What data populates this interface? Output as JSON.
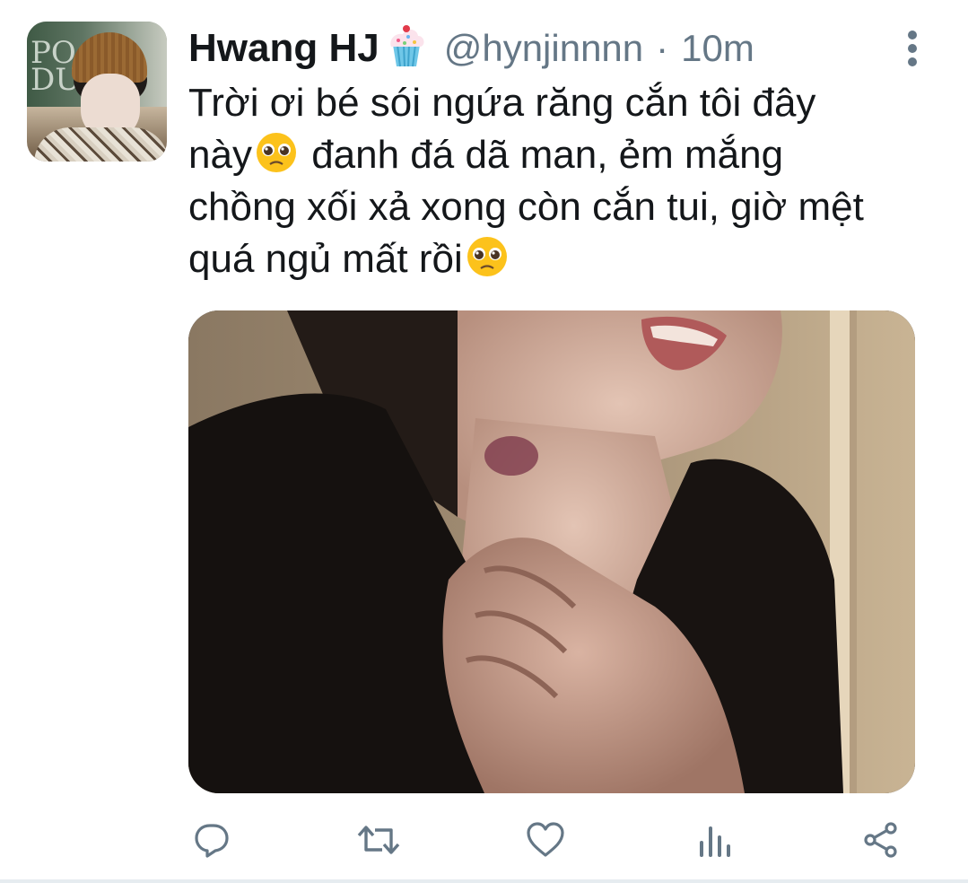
{
  "tweet": {
    "author_name": "Hwang HJ",
    "author_handle": "@hynjinnnn",
    "separator": "·",
    "time": "10m",
    "text_lines": [
      "Trời ơi bé sói ngứa răng cắn tôi đây",
      "này",
      "đanh đá dã man, ẻm mắng",
      "chồng xối xả xong còn cắn tui, giờ mệt",
      "quá ngủ mất rồi"
    ],
    "emoji_after_name": "cupcake-emoji",
    "emoji_in_text": "pleading-face-emoji"
  },
  "actions": [
    {
      "name": "reply",
      "icon": "reply-icon"
    },
    {
      "name": "retweet",
      "icon": "retweet-icon"
    },
    {
      "name": "like",
      "icon": "heart-icon"
    },
    {
      "name": "analytics",
      "icon": "analytics-icon"
    },
    {
      "name": "share",
      "icon": "share-icon"
    }
  ],
  "colors": {
    "text_primary": "#14171a",
    "text_secondary": "#657786",
    "icon": "#657786",
    "background": "#ffffff"
  }
}
